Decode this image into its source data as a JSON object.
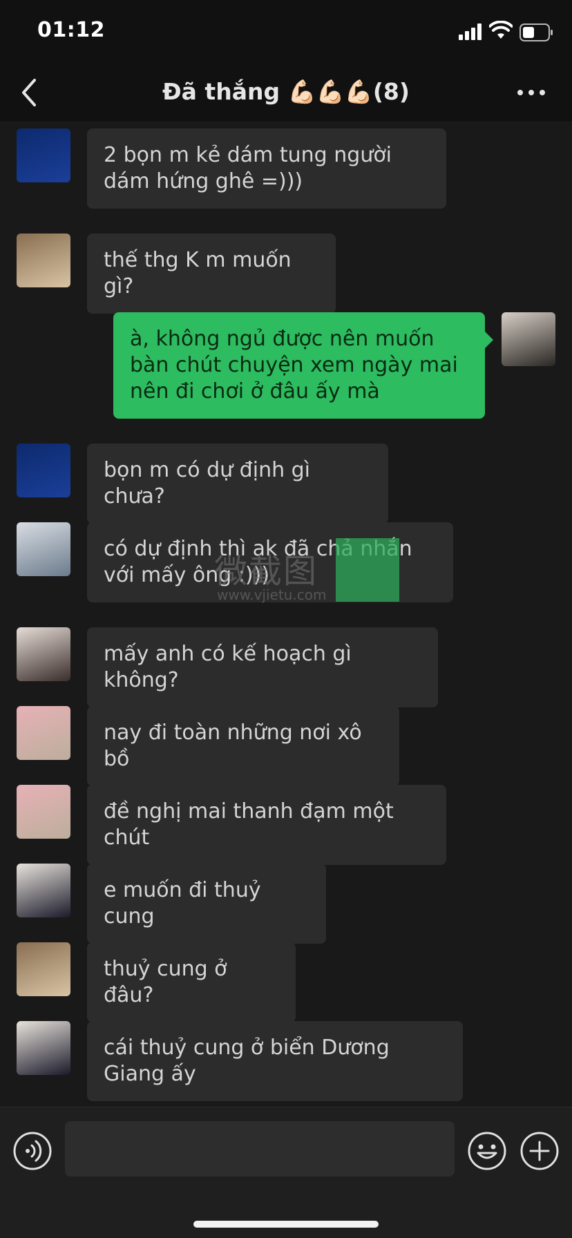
{
  "status_bar": {
    "time": "01:12"
  },
  "header": {
    "title": "Đã thắng 💪🏻💪🏻💪🏻(8)",
    "back_icon": "chevron-left-icon",
    "more_icon": "more-dots-icon"
  },
  "messages": [
    {
      "sender": "other",
      "text": "2 bọn m kẻ dám tung người dám hứng ghê =)))",
      "avatar_colors": [
        "#0d2a6e",
        "#1b3f99"
      ]
    },
    {
      "sender": "other",
      "text": "thế thg K m muốn gì?",
      "avatar_colors": [
        "#8a6f52",
        "#d8c3a5"
      ]
    },
    {
      "sender": "me",
      "text": "à, không ngủ được nên muốn bàn chút chuyện xem ngày mai nên đi chơi ở đâu ấy mà",
      "avatar_colors": [
        "#d7cfc6",
        "#2a2623"
      ]
    },
    {
      "sender": "other",
      "text": "bọn m có dự định gì chưa?",
      "avatar_colors": [
        "#0d2a6e",
        "#1b3f99"
      ]
    },
    {
      "sender": "other",
      "text": "có dự định thì ak đã chả nhắn với mấy ông :)))",
      "avatar_colors": [
        "#d9dde3",
        "#6b7b8c"
      ]
    },
    {
      "sender": "other",
      "text": "mấy anh có kế hoạch gì không?",
      "avatar_colors": [
        "#e6dcd6",
        "#3a2e2a"
      ]
    },
    {
      "sender": "other",
      "text": "nay đi toàn những nơi xô bồ",
      "avatar_colors": [
        "#e7b1b6",
        "#bcae9c"
      ]
    },
    {
      "sender": "other",
      "text": "đề nghị mai thanh đạm một chút",
      "avatar_colors": [
        "#e7b1b6",
        "#bcae9c"
      ]
    },
    {
      "sender": "other",
      "text": "e muốn đi thuỷ cung",
      "avatar_colors": [
        "#e9e3dc",
        "#1a1a2a"
      ]
    },
    {
      "sender": "other",
      "text": "thuỷ cung ở đâu?",
      "avatar_colors": [
        "#8a6f52",
        "#d8c3a5"
      ]
    },
    {
      "sender": "other",
      "text": "cái thuỷ cung ở biển Dương Giang ấy",
      "avatar_colors": [
        "#e9e3dc",
        "#1a1a2a"
      ]
    }
  ],
  "watermark": {
    "main": "微截图",
    "url": "www.vjietu.com"
  },
  "input_bar": {
    "value": "",
    "voice_icon": "voice-icon",
    "emoji_icon": "emoji-icon",
    "plus_icon": "plus-icon"
  },
  "colors": {
    "my_bubble": "#2dbc5f",
    "other_bubble": "#2c2c2c",
    "chat_bg": "#191919"
  }
}
